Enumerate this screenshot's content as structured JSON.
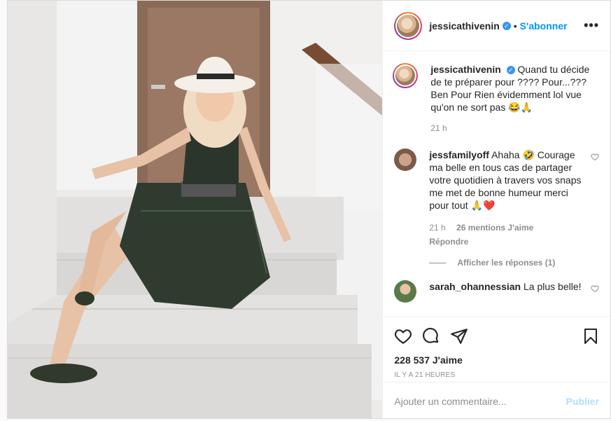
{
  "post": {
    "username": "jessicathivenin",
    "follow_label": "S'abonner",
    "separator": "•",
    "more_label": "•••",
    "caption": "Quand tu décide de te préparer pour ???? Pour...??? Ben Pour Rien évidemment lol vue qu'on ne sort pas 😂🙏",
    "caption_time": "21 h",
    "likes": "228 537 J'aime",
    "timestamp": "IL Y A 21 HEURES",
    "comment_placeholder": "Ajouter un commentaire...",
    "publish_label": "Publier"
  },
  "comments": [
    {
      "username": "jessfamilyoff",
      "text": "Ahaha 🤣 Courage ma belle en tous cas de partager votre quotidien à travers vos snaps me met de bonne humeur merci pour tout 🙏❤️",
      "time": "21 h",
      "likes": "26 mentions J'aime",
      "reply": "Répondre",
      "show_replies": "Afficher les réponses (1)"
    },
    {
      "username": "sarah_ohannessian",
      "text": "La plus belle!"
    }
  ],
  "icons": [
    "heart-icon",
    "comment-icon",
    "share-icon",
    "bookmark-icon",
    "verified-badge-icon"
  ]
}
